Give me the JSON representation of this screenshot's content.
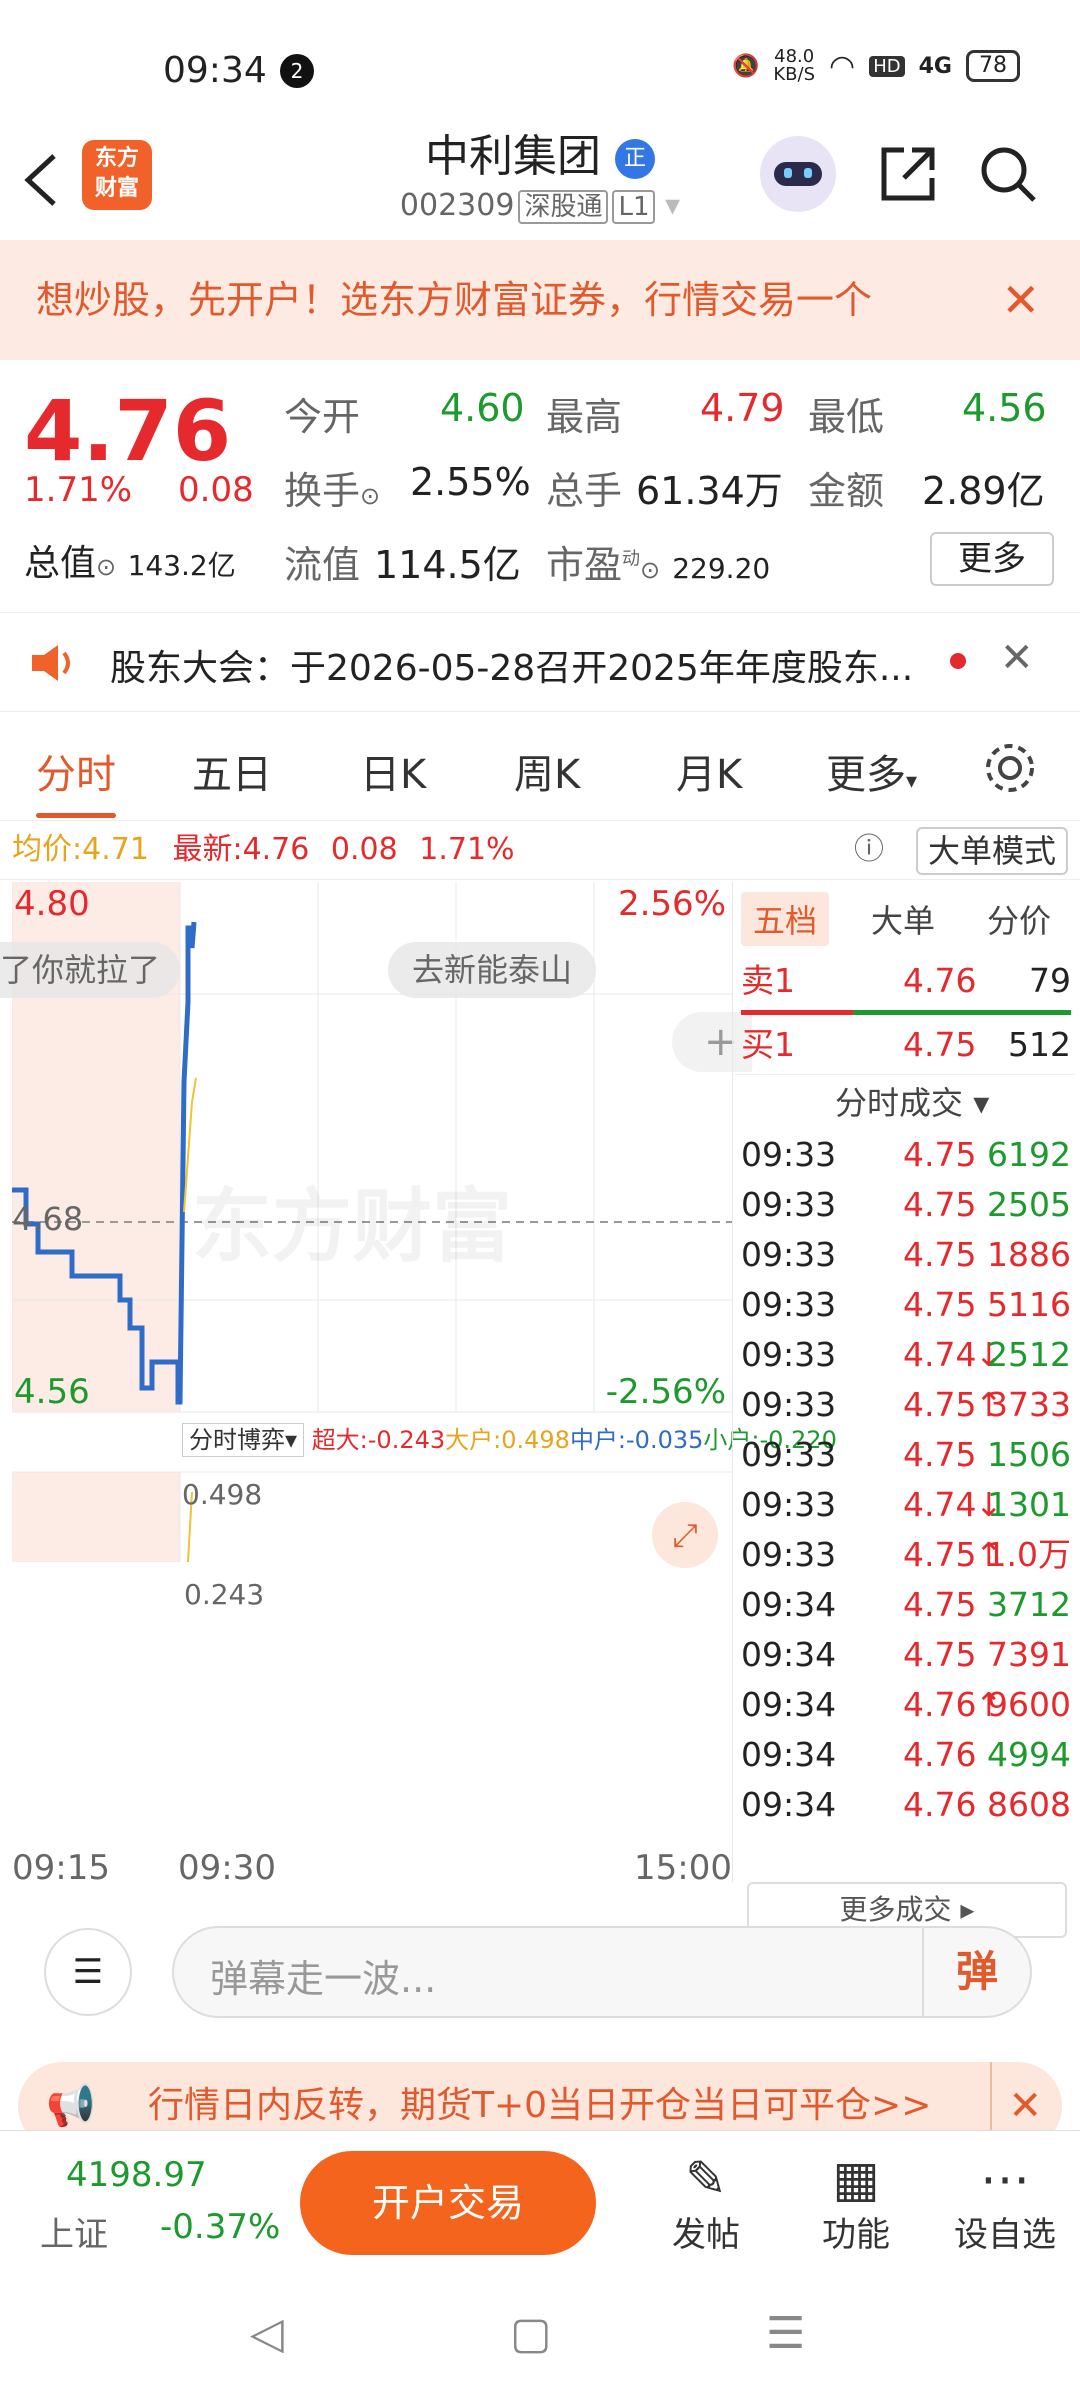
{
  "status": {
    "time": "09:34",
    "notif_count": "2",
    "net_speed": "48.0\nKB/S",
    "hd": "HD",
    "signal": "4G",
    "battery": "78"
  },
  "header": {
    "logo": "东方\n财富",
    "name": "中利集团",
    "badge": "正",
    "code": "002309",
    "market": "深股通",
    "level": "L1"
  },
  "banner": {
    "text": "想炒股，先开户！选东方财富证券，行情交易一个"
  },
  "quote": {
    "price": "4.76",
    "pct": "1.71%",
    "change": "0.08",
    "open_label": "今开",
    "open": "4.60",
    "high_label": "最高",
    "high": "4.79",
    "low_label": "最低",
    "low": "4.56",
    "turnover_label": "换手",
    "turnover": "2.55%",
    "vol_label": "总手",
    "vol": "61.34万",
    "amt_label": "金额",
    "amt": "2.89亿",
    "mcap_label": "总值",
    "mcap": "143.2亿",
    "float_label": "流值",
    "float": "114.5亿",
    "pe_label": "市盈",
    "pe_sup": "动",
    "pe": "229.20",
    "more": "更多"
  },
  "notice": {
    "text": "股东大会：于2026-05-28召开2025年年度股东..."
  },
  "tabs": [
    "分时",
    "五日",
    "日K",
    "周K",
    "月K",
    "更多"
  ],
  "avg": {
    "avg_label": "均价:",
    "avg": "4.71",
    "latest_label": "最新:",
    "latest": "4.76",
    "chg": "0.08",
    "pct": "1.71%",
    "mode": "大单模式"
  },
  "chart": {
    "top_price": "4.80",
    "top_pct": "2.56%",
    "mid_price": "4.68",
    "bot_price": "4.56",
    "bot_pct": "-2.56%",
    "danmu1": "了你就拉了",
    "danmu2": "去新能泰山",
    "watermark": "东方财富",
    "game_label": "分时博弈",
    "big": "超大:-0.243",
    "large": "大户:0.498",
    "mid": "中户:-0.035",
    "small": "小户:-0.220",
    "sub_top": "0.498",
    "sub_bot": "0.243",
    "times": [
      "09:15",
      "09:30",
      "15:00"
    ]
  },
  "book": {
    "tabs": [
      "五档",
      "大单",
      "分价"
    ],
    "sell1": {
      "label": "卖1",
      "price": "4.76",
      "vol": "79"
    },
    "buy1": {
      "label": "买1",
      "price": "4.75",
      "vol": "512"
    },
    "trades_title": "分时成交",
    "trades": [
      {
        "t": "09:33",
        "p": "4.75",
        "v": "6192",
        "c": "green",
        "a": ""
      },
      {
        "t": "09:33",
        "p": "4.75",
        "v": "2505",
        "c": "green",
        "a": ""
      },
      {
        "t": "09:33",
        "p": "4.75",
        "v": "1886",
        "c": "red",
        "a": ""
      },
      {
        "t": "09:33",
        "p": "4.75",
        "v": "5116",
        "c": "red",
        "a": ""
      },
      {
        "t": "09:33",
        "p": "4.74",
        "v": "2512",
        "c": "green",
        "a": "↓"
      },
      {
        "t": "09:33",
        "p": "4.75",
        "v": "3733",
        "c": "red",
        "a": "↑"
      },
      {
        "t": "09:33",
        "p": "4.75",
        "v": "1506",
        "c": "green",
        "a": ""
      },
      {
        "t": "09:33",
        "p": "4.74",
        "v": "1301",
        "c": "green",
        "a": "↓"
      },
      {
        "t": "09:33",
        "p": "4.75",
        "v": "1.0万",
        "c": "red",
        "a": "↑"
      },
      {
        "t": "09:34",
        "p": "4.75",
        "v": "3712",
        "c": "green",
        "a": ""
      },
      {
        "t": "09:34",
        "p": "4.75",
        "v": "7391",
        "c": "red",
        "a": ""
      },
      {
        "t": "09:34",
        "p": "4.76",
        "v": "9600",
        "c": "red",
        "a": "↑"
      },
      {
        "t": "09:34",
        "p": "4.76",
        "v": "4994",
        "c": "green",
        "a": ""
      },
      {
        "t": "09:34",
        "p": "4.76",
        "v": "8608",
        "c": "red",
        "a": ""
      }
    ],
    "more": "更多成交"
  },
  "comment": {
    "placeholder": "弹幕走一波...",
    "send": "弹"
  },
  "ad": {
    "text": "行情日内反转，期货T+0当日开仓当日可平仓>>"
  },
  "bottom": {
    "index_val": "4198.97",
    "index_name": "上证",
    "index_pct": "-0.37%",
    "open_btn": "开户交易",
    "post": "发帖",
    "func": "功能",
    "watch": "设自选"
  }
}
